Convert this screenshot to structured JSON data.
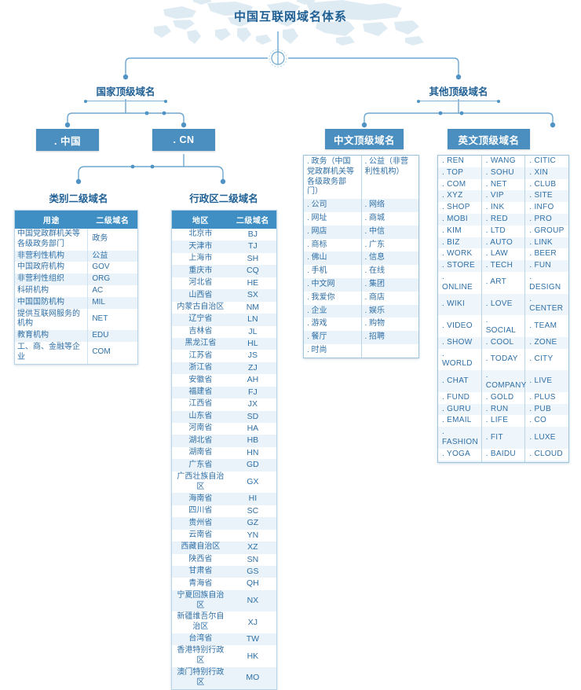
{
  "page": {
    "title": "中国互联网域名体系",
    "accent_color": "#4a8fc0",
    "header_color": "#3f8fc4",
    "text_color": "#2f6fa5",
    "stripe_color": "#eaf3fa"
  },
  "tree": {
    "root_label": "中国互联网域名体系",
    "level1": [
      {
        "label": "国家顶级域名"
      },
      {
        "label": "其他顶级域名"
      }
    ],
    "level2": [
      {
        "label": ". 中国"
      },
      {
        "label": ". CN"
      },
      {
        "label": "中文顶级域名"
      },
      {
        "label": "英文顶级域名"
      }
    ],
    "level3": [
      {
        "label": "类别二级域名"
      },
      {
        "label": "行政区二级域名"
      }
    ]
  },
  "category_table": {
    "caption": "类别二级域名",
    "headers": [
      "用途",
      "二级域名"
    ],
    "rows": [
      {
        "use": "中国党政群机关等各级政务部门",
        "domain": "政务"
      },
      {
        "use": "非营利性机构",
        "domain": "公益"
      },
      {
        "use": "中国政府机构",
        "domain": "GOV"
      },
      {
        "use": "非营利性组织",
        "domain": "ORG"
      },
      {
        "use": "科研机构",
        "domain": "AC"
      },
      {
        "use": "中国国防机构",
        "domain": "MIL"
      },
      {
        "use": "提供互联网服务的机构",
        "domain": "NET"
      },
      {
        "use": "教育机构",
        "domain": "EDU"
      },
      {
        "use": "工、商、金融等企业",
        "domain": "COM"
      }
    ]
  },
  "region_table": {
    "caption": "行政区二级域名",
    "headers": [
      "地区",
      "二级域名"
    ],
    "rows": [
      {
        "region": "北京市",
        "code": "BJ"
      },
      {
        "region": "天津市",
        "code": "TJ"
      },
      {
        "region": "上海市",
        "code": "SH"
      },
      {
        "region": "重庆市",
        "code": "CQ"
      },
      {
        "region": "河北省",
        "code": "HE"
      },
      {
        "region": "山西省",
        "code": "SX"
      },
      {
        "region": "内蒙古自治区",
        "code": "NM"
      },
      {
        "region": "辽宁省",
        "code": "LN"
      },
      {
        "region": "吉林省",
        "code": "JL"
      },
      {
        "region": "黑龙江省",
        "code": "HL"
      },
      {
        "region": "江苏省",
        "code": "JS"
      },
      {
        "region": "浙江省",
        "code": "ZJ"
      },
      {
        "region": "安徽省",
        "code": "AH"
      },
      {
        "region": "福建省",
        "code": "FJ"
      },
      {
        "region": "江西省",
        "code": "JX"
      },
      {
        "region": "山东省",
        "code": "SD"
      },
      {
        "region": "河南省",
        "code": "HA"
      },
      {
        "region": "湖北省",
        "code": "HB"
      },
      {
        "region": "湖南省",
        "code": "HN"
      },
      {
        "region": "广东省",
        "code": "GD"
      },
      {
        "region": "广西壮族自治区",
        "code": "GX"
      },
      {
        "region": "海南省",
        "code": "HI"
      },
      {
        "region": "四川省",
        "code": "SC"
      },
      {
        "region": "贵州省",
        "code": "GZ"
      },
      {
        "region": "云南省",
        "code": "YN"
      },
      {
        "region": "西藏自治区",
        "code": "XZ"
      },
      {
        "region": "陕西省",
        "code": "SN"
      },
      {
        "region": "甘肃省",
        "code": "GS"
      },
      {
        "region": "青海省",
        "code": "QH"
      },
      {
        "region": "宁夏回族自治区",
        "code": "NX"
      },
      {
        "region": "新疆维吾尔自治区",
        "code": "XJ"
      },
      {
        "region": "台湾省",
        "code": "TW"
      },
      {
        "region": "香港特别行政区",
        "code": "HK"
      },
      {
        "region": "澳门特别行政区",
        "code": "MO"
      }
    ]
  },
  "chinese_tld_table": {
    "caption": "中文顶级域名",
    "columns": [
      [
        ". 政务（中国党政群机关等各级政务部门）",
        ". 公司",
        ". 网址",
        ". 网店",
        ". 商标",
        ". 佛山",
        ". 手机",
        ". 中文网",
        ". 我爱你",
        ". 企业",
        ". 游戏",
        ". 餐厅",
        ". 时尚"
      ],
      [
        ". 公益（非营利性机构）",
        ". 网络",
        ". 商城",
        ". 中信",
        ". 广东",
        ". 信息",
        ". 在线",
        ". 集团",
        ". 商店",
        ". 娱乐",
        ". 购物",
        ". 招聘",
        ""
      ]
    ]
  },
  "english_tld_table": {
    "caption": "英文顶级域名",
    "columns": [
      [
        ". REN",
        ". TOP",
        ". COM",
        ". XYZ",
        ". SHOP",
        ". MOBI",
        ". KIM",
        ". BIZ",
        ". WORK",
        ". STORE",
        ". ONLINE",
        ". WIKI",
        ". VIDEO",
        ". SHOW",
        ". WORLD",
        ". CHAT",
        ". FUND",
        ". GURU",
        ". EMAIL",
        ". FASHION",
        ". YOGA",
        ""
      ],
      [
        ". WANG",
        ". SOHU",
        ". NET",
        ". VIP",
        ". INK",
        ". RED",
        ". LTD",
        ". AUTO",
        ". LAW",
        ". TECH",
        ". ART",
        ". LOVE",
        ". SOCIAL",
        ". COOL",
        ". TODAY",
        ". COMPANY",
        ". GOLD",
        ". RUN",
        ". LIFE",
        ". FIT",
        ". BAIDU",
        ""
      ],
      [
        ". CITIC",
        ". XIN",
        ". CLUB",
        ". SITE",
        ". INFO",
        ". PRO",
        ". GROUP",
        ". LINK",
        ". BEER",
        ". FUN",
        ". DESIGN",
        ". CENTER",
        ". TEAM",
        ". ZONE",
        ". CITY",
        ". LIVE",
        ". PLUS",
        ". PUB",
        ". CO",
        ". LUXE",
        ". CLOUD",
        ""
      ]
    ]
  }
}
